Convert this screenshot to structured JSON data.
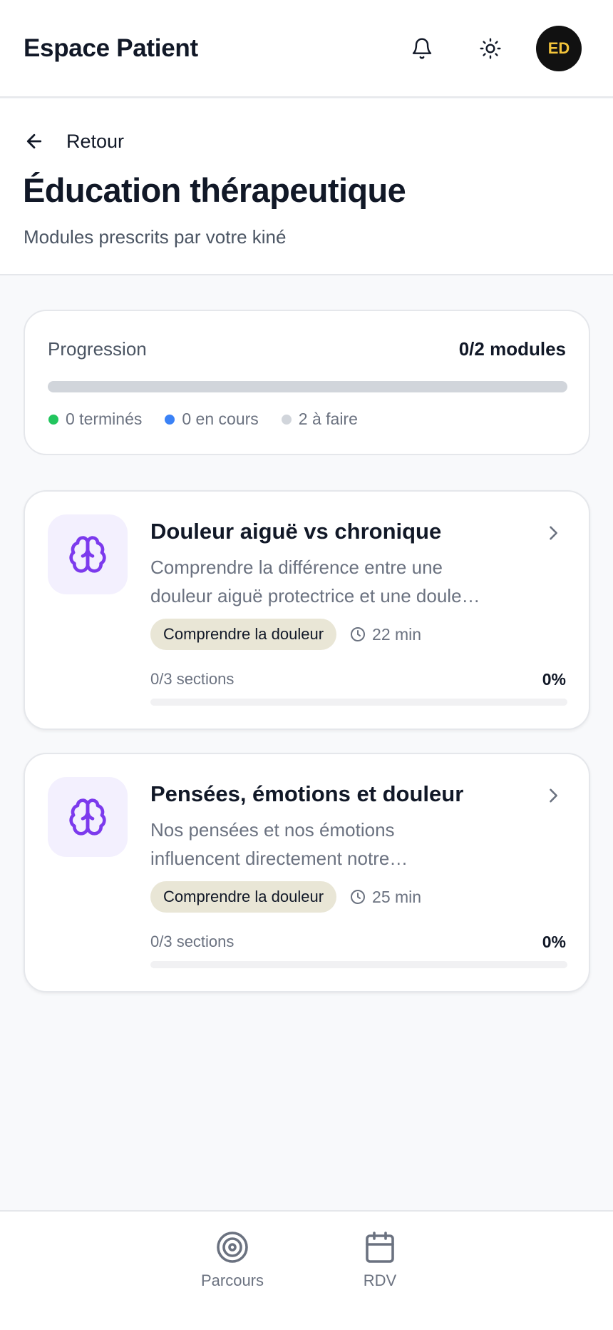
{
  "header": {
    "title": "Espace Patient",
    "avatar_initials": "ED"
  },
  "page": {
    "back_label": "Retour",
    "title": "Éducation thérapeutique",
    "subtitle": "Modules prescrits par votre kiné"
  },
  "progress": {
    "label": "Progression",
    "count": "0/2 modules",
    "fraction": 0,
    "legend": [
      {
        "label": "0 terminés",
        "color": "#22c55e"
      },
      {
        "label": "0 en cours",
        "color": "#3b82f6"
      },
      {
        "label": "2 à faire",
        "color": "#d1d5db"
      }
    ]
  },
  "modules": [
    {
      "title": "Douleur aiguë vs chronique",
      "desc_line1": "Comprendre la différence entre une",
      "desc_line2": "douleur aiguë protectrice et une doule…",
      "tag": "Comprendre la douleur",
      "duration": "22 min",
      "sections": "0/3 sections",
      "percent_label": "0%",
      "fraction": 0
    },
    {
      "title": "Pensées, émotions et douleur",
      "desc_line1": "Nos pensées et nos émotions",
      "desc_line2": "influencent directement notre…",
      "tag": "Comprendre la douleur",
      "duration": "25 min",
      "sections": "0/3 sections",
      "percent_label": "0%",
      "fraction": 0
    }
  ],
  "nav": [
    {
      "label": "Parcours",
      "icon": "target-icon"
    },
    {
      "label": "RDV",
      "icon": "calendar-icon"
    }
  ],
  "colors": {
    "accent": "#7c3aed",
    "icon_bg": "#f3f0fe",
    "tag_bg": "#e9e6d6",
    "avatar_bg": "#111111",
    "avatar_text": "#f3c43a"
  }
}
